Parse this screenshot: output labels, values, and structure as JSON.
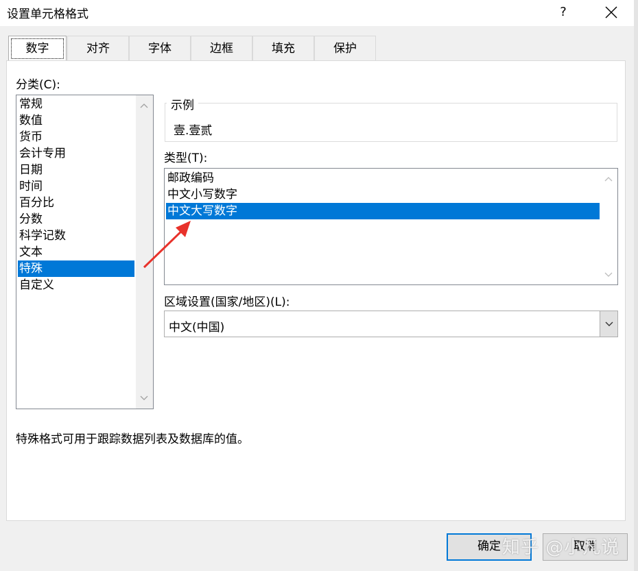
{
  "window": {
    "title": "设置单元格格式",
    "help_label": "?",
    "close_icon": "close-icon"
  },
  "tabs": [
    {
      "label": "数字",
      "active": true
    },
    {
      "label": "对齐",
      "active": false
    },
    {
      "label": "字体",
      "active": false
    },
    {
      "label": "边框",
      "active": false
    },
    {
      "label": "填充",
      "active": false
    },
    {
      "label": "保护",
      "active": false
    }
  ],
  "category": {
    "label": "分类(C):",
    "items": [
      "常规",
      "数值",
      "货币",
      "会计专用",
      "日期",
      "时间",
      "百分比",
      "分数",
      "科学记数",
      "文本",
      "特殊",
      "自定义"
    ],
    "selected": "特殊"
  },
  "sample": {
    "legend": "示例",
    "value": "壹.壹贰"
  },
  "type": {
    "label": "类型(T):",
    "items": [
      "邮政编码",
      "中文小写数字",
      "中文大写数字"
    ],
    "selected": "中文大写数字"
  },
  "locale": {
    "label": "区域设置(国家/地区)(L):",
    "value": "中文(中国)"
  },
  "description": "特殊格式可用于跟踪数据列表及数据库的值。",
  "buttons": {
    "ok": "确定",
    "cancel": "取消"
  },
  "watermark": "知乎 @小凡说",
  "colors": {
    "selection": "#0078d7",
    "annotation_arrow": "#e8322b"
  }
}
